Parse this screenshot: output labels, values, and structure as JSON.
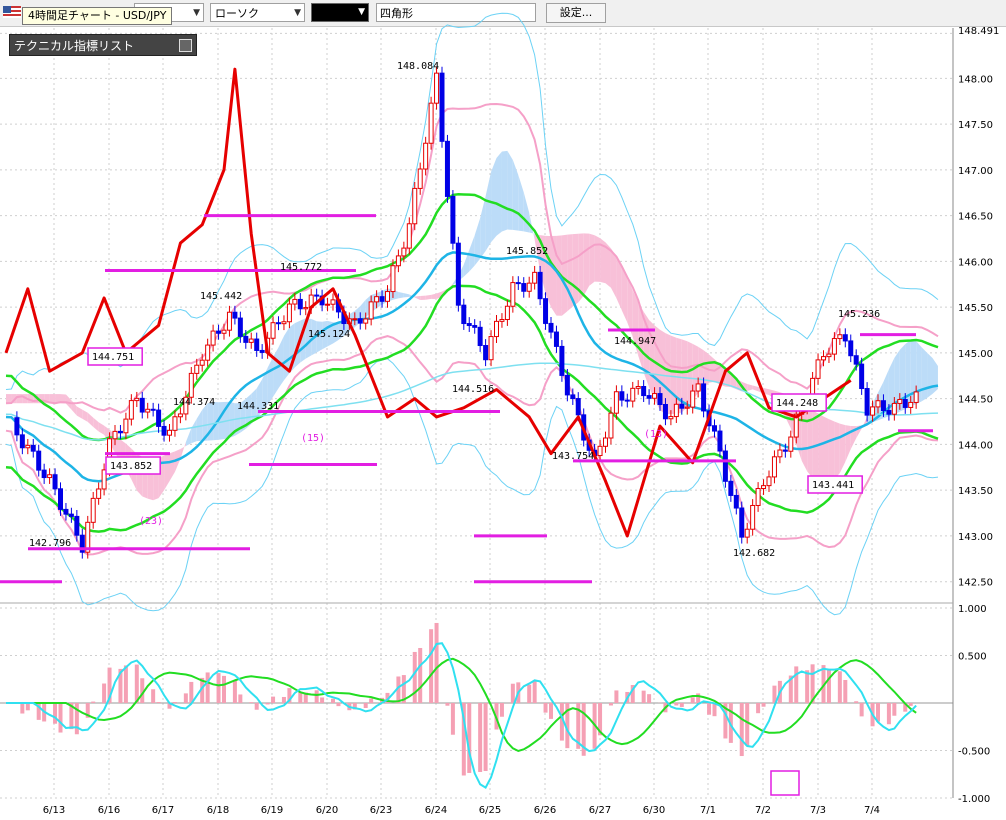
{
  "toolbar": {
    "tooltip": "4時間足チャート - USD/JPY",
    "period_label": "足",
    "style_label": "ローソク",
    "color_label": "",
    "shape_label": "四角形",
    "settings_label": "設定..."
  },
  "tech_list": {
    "title": "テクニカル指標リスト"
  },
  "chart_data": {
    "type": "line",
    "title": "",
    "x_ticks": [
      "6/13",
      "6/16",
      "6/17",
      "6/18",
      "6/19",
      "6/20",
      "6/23",
      "6/24",
      "6/25",
      "6/26",
      "6/27",
      "6/30",
      "7/1",
      "7/2",
      "7/3",
      "7/4"
    ],
    "price_axis": {
      "ticks": [
        "148.491",
        "148.00",
        "147.50",
        "147.00",
        "146.50",
        "146.00",
        "145.50",
        "145.00",
        "144.50",
        "144.00",
        "143.50",
        "143.00",
        "142.50"
      ],
      "ylim": [
        142.3,
        148.55
      ]
    },
    "osc_axis": {
      "ticks": [
        "1.000",
        "0.500",
        "-0.500",
        "-1.000"
      ],
      "ylim": [
        -1.0,
        1.0
      ]
    },
    "annotations": [
      {
        "text": "148.084",
        "boxed": false
      },
      {
        "text": "145.852",
        "boxed": false
      },
      {
        "text": "145.772",
        "boxed": false
      },
      {
        "text": "145.442",
        "boxed": false
      },
      {
        "text": "145.236",
        "boxed": false
      },
      {
        "text": "145.124",
        "boxed": false
      },
      {
        "text": "144.947",
        "boxed": false
      },
      {
        "text": "144.751",
        "boxed": true
      },
      {
        "text": "144.516",
        "boxed": false
      },
      {
        "text": "144.374",
        "boxed": false
      },
      {
        "text": "144.331",
        "boxed": false
      },
      {
        "text": "144.248",
        "boxed": true
      },
      {
        "text": "143.852",
        "boxed": true
      },
      {
        "text": "143.754",
        "boxed": false
      },
      {
        "text": "143.441",
        "boxed": true
      },
      {
        "text": "142.796",
        "boxed": false
      },
      {
        "text": "142.682",
        "boxed": false
      },
      {
        "text": "(23)",
        "boxed": false
      },
      {
        "text": "(15)",
        "boxed": false
      },
      {
        "text": "(13)",
        "boxed": false
      }
    ],
    "colors": {
      "up": "#e60000",
      "down": "#0000e6",
      "red_line": "#e60000",
      "green_line": "#22dd22",
      "blue_line": "#1eb4e6",
      "band_outer": "#6cd2f5",
      "band_pink": "#f5a0c8",
      "cloud_blue": "#bcdcf8",
      "cloud_pink": "#f8c0d8",
      "magenta": "#e21ee2",
      "macd_hist": "#f5a0b4"
    }
  }
}
